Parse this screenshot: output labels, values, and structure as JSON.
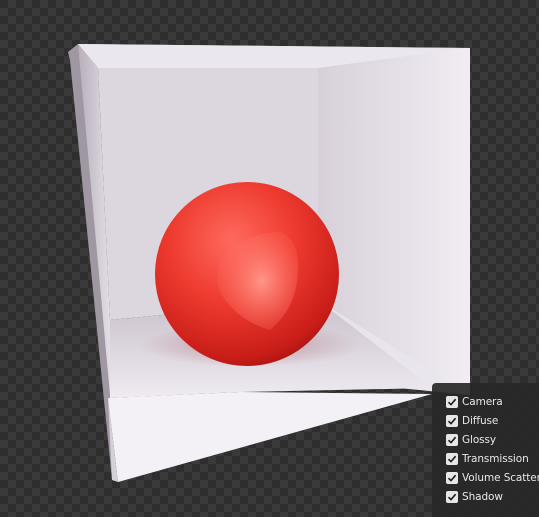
{
  "viewport": {
    "label": "render-preview",
    "background": "checkerboard-transparency"
  },
  "render_passes": {
    "items": [
      {
        "label": "Camera",
        "checked": true
      },
      {
        "label": "Diffuse",
        "checked": true
      },
      {
        "label": "Glossy",
        "checked": true
      },
      {
        "label": "Transmission",
        "checked": true
      },
      {
        "label": "Volume Scatter",
        "checked": true
      },
      {
        "label": "Shadow",
        "checked": true
      }
    ]
  },
  "colors": {
    "sphere": "#e8322c",
    "box_interior": "#e9e4ec",
    "panel_bg": "#282828",
    "checkbox_bg": "#e6e6e6"
  }
}
